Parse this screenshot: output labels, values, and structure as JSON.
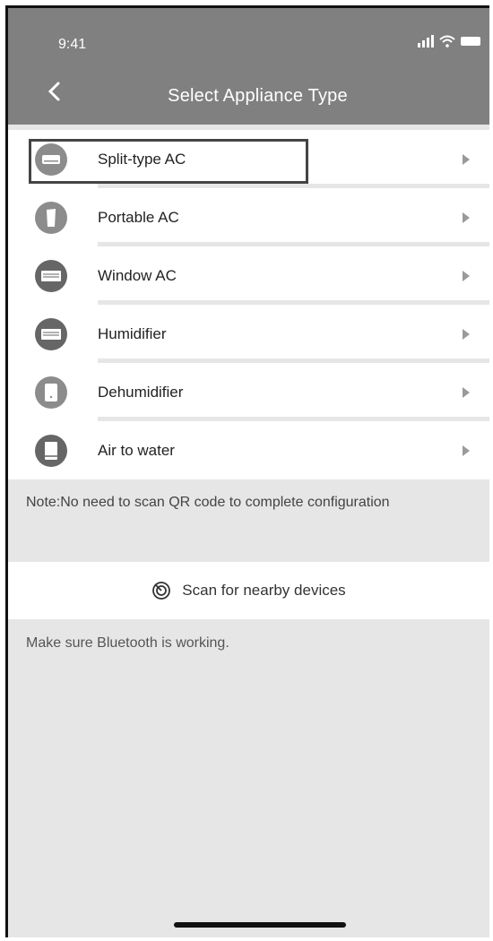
{
  "status_bar": {
    "time": "9:41"
  },
  "nav": {
    "title": "Select Appliance Type"
  },
  "appliances": [
    {
      "label": "Split-type AC",
      "icon": "split-ac-icon"
    },
    {
      "label": "Portable AC",
      "icon": "portable-ac-icon"
    },
    {
      "label": "Window AC",
      "icon": "window-ac-icon"
    },
    {
      "label": "Humidifier",
      "icon": "humidifier-icon"
    },
    {
      "label": "Dehumidifier",
      "icon": "dehumidifier-icon"
    },
    {
      "label": "Air to water",
      "icon": "air-to-water-icon"
    }
  ],
  "note": {
    "text": "Note:No need to scan QR code to complete configuration"
  },
  "scan": {
    "label": "Scan for nearby devices",
    "icon": "scan-icon"
  },
  "hint": {
    "text": "Make sure Bluetooth is working."
  },
  "colors": {
    "header": "#808080",
    "background": "#e6e6e6",
    "row": "#ffffff",
    "icon": "#8c8c8c"
  }
}
